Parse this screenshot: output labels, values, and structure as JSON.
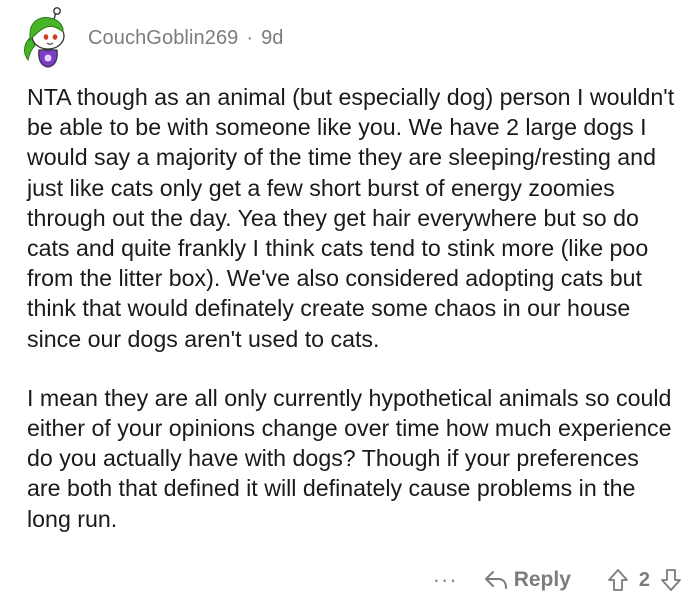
{
  "comment": {
    "author": "CouchGoblin269",
    "separator": "·",
    "age": "9d",
    "paragraphs": [
      "NTA though as an animal (but especially dog) person I wouldn't be able to be with someone like you. We have 2 large dogs I would say a majority of the time they are sleeping/resting and just like cats only get a few short burst of energy zoomies through out the day. Yea they get hair everywhere but so do cats and quite frankly I think cats tend to stink more (like poo from the litter box). We've also considered adopting cats but think that would definately create some chaos in our house since our dogs aren't used to cats.",
      "I mean they are all only currently hypothetical animals so could either of your opinions change over time how much experience do you actually have with dogs? Though if your preferences are both that defined it will definately cause problems in the long run."
    ]
  },
  "actions": {
    "more_label": "···",
    "reply_label": "Reply",
    "score": "2",
    "icons": [
      "more-icon",
      "reply-icon",
      "upvote-icon",
      "downvote-icon"
    ]
  },
  "colors": {
    "text": "#1a1a1b",
    "meta": "#7c7c7c",
    "avatar_hair": "#46b526",
    "avatar_shirt": "#7d3cc6"
  }
}
